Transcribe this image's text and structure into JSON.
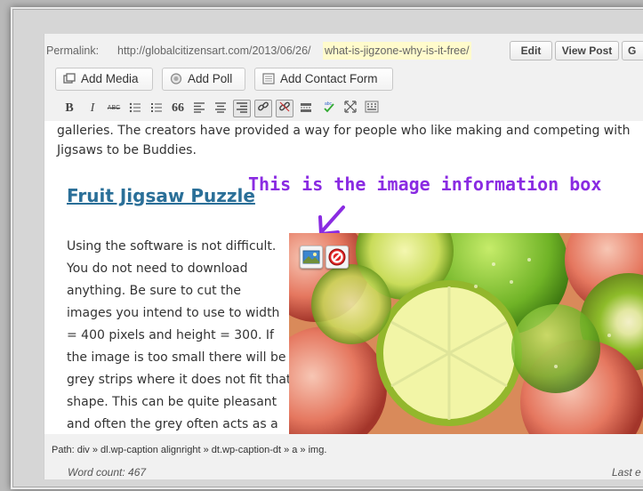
{
  "permalink": {
    "label": "Permalink:",
    "base_url": "http://globalcitizensart.com/2013/06/26/",
    "slug": "what-is-jigzone-why-is-it-free/",
    "edit_button": "Edit",
    "view_post_button": "View Post",
    "get_shortlink_button": "G"
  },
  "media_buttons": {
    "add_media": "Add Media",
    "add_poll": "Add Poll",
    "add_contact_form": "Add Contact Form"
  },
  "toolbar": {
    "bold": "B",
    "italic": "I",
    "strike": "ABC",
    "quote": "66"
  },
  "content": {
    "intro_line1": "galleries.  The creators have provided a way for people who like making and competing with",
    "intro_line2": "Jigsaws to be Buddies.",
    "heading": "Fruit Jigsaw Puzzle",
    "annotation": "This is the image information box",
    "body_lines": [
      "Using the software is not difficult.",
      "You do not need to download",
      "anything.  Be sure to cut the",
      "images you intend to use to width",
      "= 400 pixels and height = 300.  If",
      "the image is too small there will be",
      "grey strips where it does not fit that",
      "shape.  This can be quite pleasant",
      "and often the grey often acts as a"
    ]
  },
  "footer": {
    "path": "Path: div » dl.wp-caption alignright » dt.wp-caption-dt » a » img.",
    "word_count": "Word count: 467",
    "last_edited": "Last e"
  },
  "colors": {
    "heading_link": "#2a6f98",
    "annotation": "#8a2be2",
    "slug_highlight": "#fffbcc"
  },
  "icons": [
    "poll-icon",
    "media-icon",
    "contact-form-icon",
    "edit-image-icon",
    "delete-image-icon"
  ]
}
